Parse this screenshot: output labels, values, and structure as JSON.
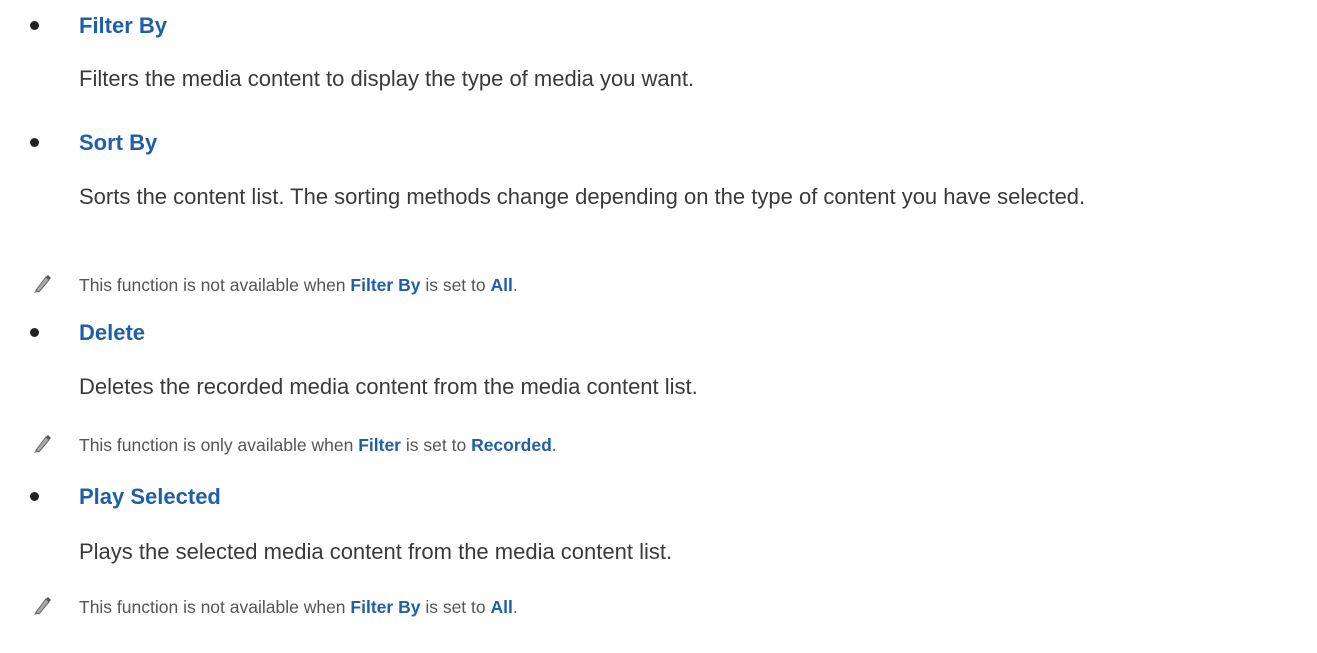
{
  "items": [
    {
      "title": "Filter By",
      "description": "Filters the media content to display the type of media you want."
    },
    {
      "title": "Sort By",
      "description": "Sorts the content list. The sorting methods change depending on the type of content you have selected.",
      "note": {
        "pre": "This function is not available when",
        "term1": "Filter By",
        "mid": "is set to",
        "term2": "All",
        "post": "."
      }
    },
    {
      "title": "Delete",
      "description": "Deletes the recorded media content from the media content list.",
      "note": {
        "pre": "This function is only available when",
        "term1": "Filter",
        "mid": "is set to",
        "term2": "Recorded",
        "post": "."
      }
    },
    {
      "title": "Play Selected",
      "description": "Plays the selected media content from the media content list.",
      "note": {
        "pre": "This function is not available when",
        "term1": "Filter By",
        "mid": "is set to",
        "term2": "All",
        "post": "."
      }
    }
  ],
  "colors": {
    "accent": "#1f5fa8",
    "body_text": "#3a3a3a",
    "note_text": "#555555"
  },
  "icons": {
    "note": "pencil-icon",
    "bullet": "bullet-dot"
  }
}
